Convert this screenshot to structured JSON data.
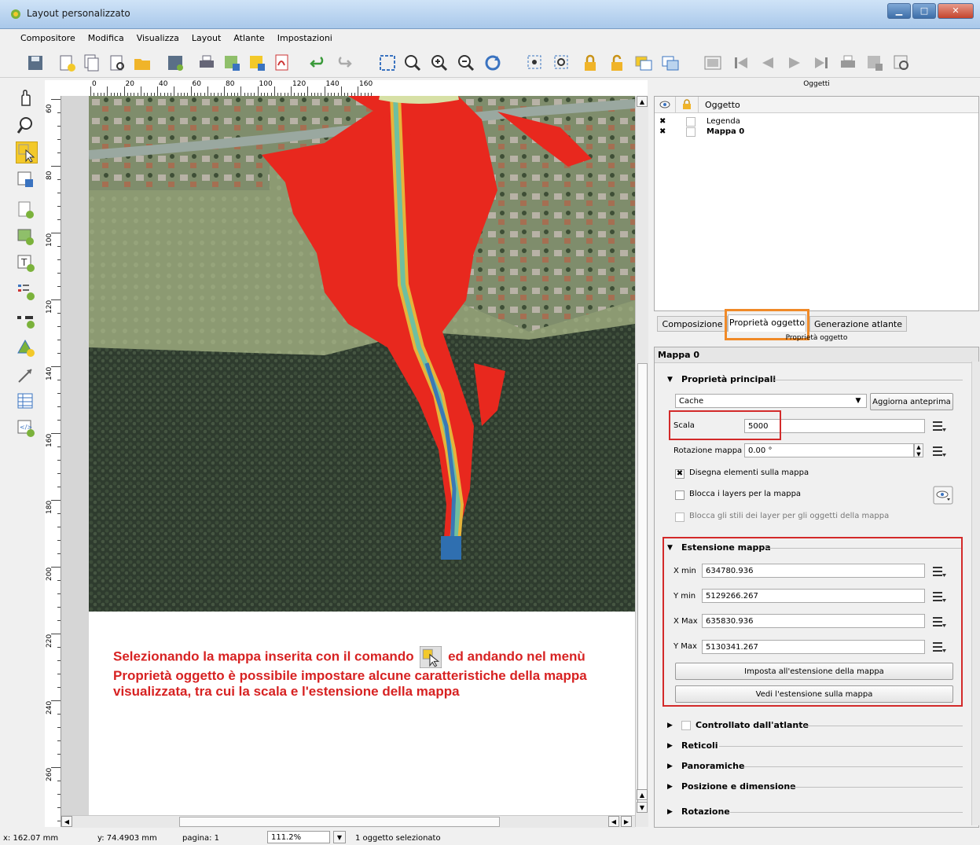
{
  "window": {
    "title": "Layout personalizzato",
    "minimize": "▁",
    "maximize": "□",
    "close": "✕"
  },
  "menu": [
    "Compositore",
    "Modifica",
    "Visualizza",
    "Layout",
    "Atlante",
    "Impostazioni"
  ],
  "ruler": {
    "h_labels": [
      "0",
      "20",
      "40",
      "60",
      "80",
      "100",
      "120",
      "140",
      "160"
    ],
    "v_labels": [
      "60",
      "80",
      "100",
      "120",
      "140",
      "160",
      "180",
      "200",
      "220",
      "240",
      "260"
    ]
  },
  "caption": {
    "part1": "Selezionando la mappa inserita con il comando",
    "part2": "ed andando nel menù Proprietà oggetto è possibile impostare alcune caratteristiche della mappa visualizzata, tra cui la scala e l'estensione della mappa"
  },
  "status": {
    "x": "x: 162.07 mm",
    "y": "y: 74.4903 mm",
    "page": "pagina: 1",
    "zoom": "111.2%",
    "selected": "1 oggetto selezionato"
  },
  "objects_panel": {
    "header": "Oggetti",
    "column": "Oggetto",
    "items": [
      {
        "name": "Legenda",
        "visible": "✖"
      },
      {
        "name": "Mappa 0",
        "visible": "✖"
      }
    ]
  },
  "tabs": [
    "Composizione",
    "Proprietà oggetto",
    "Generazione atlante"
  ],
  "properties": {
    "header": "Proprietà oggetto",
    "title": "Mappa 0",
    "main_section": "Proprietà principali",
    "cache_option": "Cache",
    "update_preview": "Aggiorna anteprima",
    "scale_label": "Scala",
    "scale_value": "5000",
    "rotation_label": "Rotazione mappa",
    "rotation_value": "0.00 °",
    "draw_items": "Disegna elementi sulla mappa",
    "lock_layers": "Blocca i layers per la mappa",
    "lock_styles": "Blocca gli stili dei layer per gli oggetti della mappa",
    "extent_section": "Estensione mappa",
    "xmin_label": "X min",
    "xmin_value": "634780.936",
    "ymin_label": "Y min",
    "ymin_value": "5129266.267",
    "xmax_label": "X Max",
    "xmax_value": "635830.936",
    "ymax_label": "Y Max",
    "ymax_value": "5130341.267",
    "set_extent_btn": "Imposta all'estensione della mappa",
    "view_extent_btn": "Vedi l'estensione sulla mappa",
    "atlas_section": "Controllato dall'atlante",
    "grids_section": "Reticoli",
    "overviews_section": "Panoramiche",
    "position_section": "Posizione e dimensione",
    "rotation_section": "Rotazione"
  },
  "colors": {
    "accent_orange": "#f08a28",
    "highlight_red": "#d32a2a",
    "caption_red": "#d72222",
    "flood_red": "#e8281e"
  }
}
